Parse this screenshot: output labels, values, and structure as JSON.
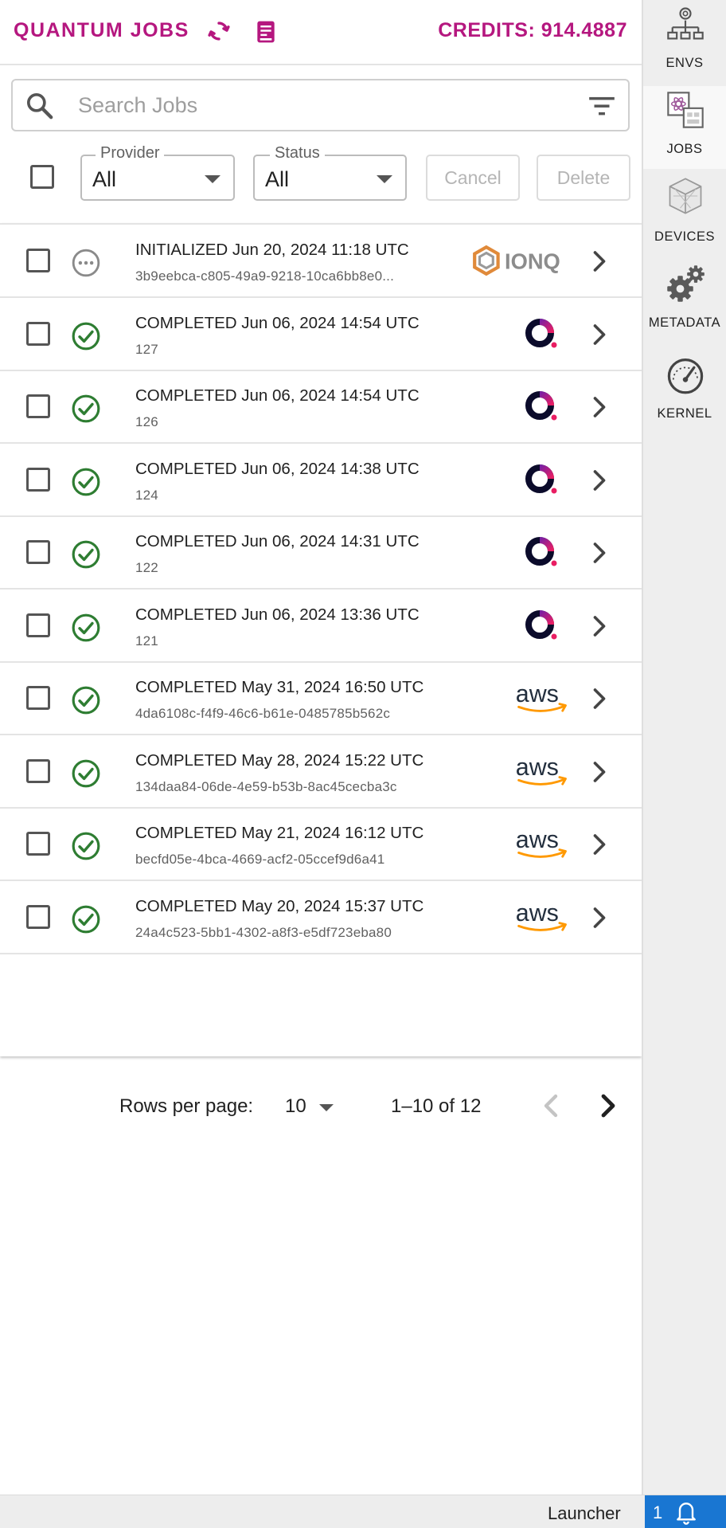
{
  "header": {
    "title": "QUANTUM JOBS",
    "credits": "CREDITS: 914.4887",
    "accent_color": "#b5177f",
    "icons": [
      "refresh-icon",
      "documentation-book-icon"
    ]
  },
  "search": {
    "placeholder": "Search Jobs",
    "value": ""
  },
  "filters": {
    "provider_label": "Provider",
    "provider_value": "All",
    "status_label": "Status",
    "status_value": "All"
  },
  "actions": {
    "cancel_label": "Cancel",
    "delete_label": "Delete"
  },
  "jobs": [
    {
      "status": "INITIALIZED",
      "title": "INITIALIZED Jun 20, 2024 11:18 UTC",
      "id": "3b9eebca-c805-49a9-9218-10ca6bb8e0...",
      "provider": "ionq",
      "provider_text": "IONQ"
    },
    {
      "status": "COMPLETED",
      "title": "COMPLETED Jun 06, 2024 14:54 UTC",
      "id": "127",
      "provider": "oqc",
      "provider_text": ""
    },
    {
      "status": "COMPLETED",
      "title": "COMPLETED Jun 06, 2024 14:54 UTC",
      "id": "126",
      "provider": "oqc",
      "provider_text": ""
    },
    {
      "status": "COMPLETED",
      "title": "COMPLETED Jun 06, 2024 14:38 UTC",
      "id": "124",
      "provider": "oqc",
      "provider_text": ""
    },
    {
      "status": "COMPLETED",
      "title": "COMPLETED Jun 06, 2024 14:31 UTC",
      "id": "122",
      "provider": "oqc",
      "provider_text": ""
    },
    {
      "status": "COMPLETED",
      "title": "COMPLETED Jun 06, 2024 13:36 UTC",
      "id": "121",
      "provider": "oqc",
      "provider_text": ""
    },
    {
      "status": "COMPLETED",
      "title": "COMPLETED May 31, 2024 16:50 UTC",
      "id": "4da6108c-f4f9-46c6-b61e-0485785b562c",
      "provider": "aws",
      "provider_text": "aws"
    },
    {
      "status": "COMPLETED",
      "title": "COMPLETED May 28, 2024 15:22 UTC",
      "id": "134daa84-06de-4e59-b53b-8ac45cecba3c",
      "provider": "aws",
      "provider_text": "aws"
    },
    {
      "status": "COMPLETED",
      "title": "COMPLETED May 21, 2024 16:12 UTC",
      "id": "becfd05e-4bca-4669-acf2-05ccef9d6a41",
      "provider": "aws",
      "provider_text": "aws"
    },
    {
      "status": "COMPLETED",
      "title": "COMPLETED May 20, 2024 15:37 UTC",
      "id": "24a4c523-5bb1-4302-a8f3-e5df723eba80",
      "provider": "aws",
      "provider_text": "aws"
    }
  ],
  "status_colors": {
    "completed": "#2e7d32",
    "initialized": "#8a8a8a"
  },
  "pagination": {
    "rows_label": "Rows per page:",
    "rows_value": "10",
    "range": "1–10 of 12"
  },
  "sidebar": {
    "items": [
      {
        "label": "ENVS",
        "icon": "environments-icon",
        "active": false
      },
      {
        "label": "JOBS",
        "icon": "jobs-icon",
        "active": true
      },
      {
        "label": "DEVICES",
        "icon": "devices-cube-icon",
        "active": false
      },
      {
        "label": "METADATA",
        "icon": "gears-icon",
        "active": false
      },
      {
        "label": "KERNEL",
        "icon": "speedometer-icon",
        "active": false
      }
    ]
  },
  "statusbar": {
    "launcher": "Launcher",
    "notifications": "1",
    "notif_color": "#1976d2"
  }
}
